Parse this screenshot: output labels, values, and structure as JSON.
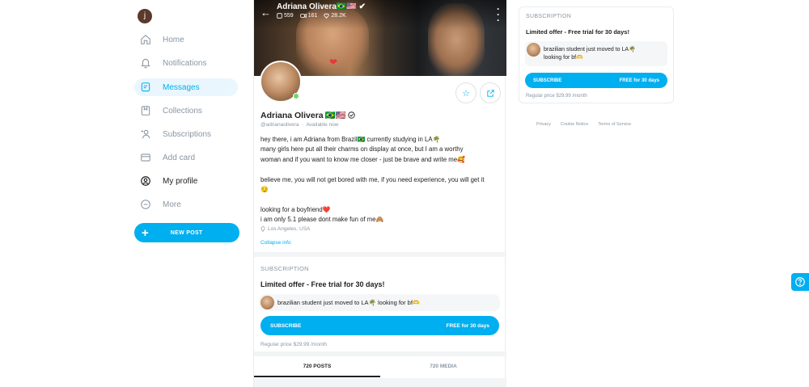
{
  "sidebar": {
    "avatar_letter": "j",
    "items": [
      {
        "label": "Home",
        "icon": "home-icon",
        "state": "normal"
      },
      {
        "label": "Notifications",
        "icon": "bell-icon",
        "state": "normal"
      },
      {
        "label": "Messages",
        "icon": "message-icon",
        "state": "active"
      },
      {
        "label": "Collections",
        "icon": "bookmark-icon",
        "state": "normal"
      },
      {
        "label": "Subscriptions",
        "icon": "subscriptions-icon",
        "state": "normal"
      },
      {
        "label": "Add card",
        "icon": "card-icon",
        "state": "normal"
      },
      {
        "label": "My profile",
        "icon": "profile-icon",
        "state": "strong"
      },
      {
        "label": "More",
        "icon": "more-icon",
        "state": "normal"
      }
    ],
    "new_post_label": "NEW POST"
  },
  "profile": {
    "cover_name": "Adriana Olivera",
    "flags": "🇧🇷🇺🇸",
    "stats": {
      "photos": "559",
      "videos": "161",
      "likes": "28.2K"
    },
    "name": "Adriana Olivera",
    "handle": "@adrianaolivera",
    "status": "Available now",
    "bio_lines": [
      "hey there, i am Adriana from Brazil🇧🇷 currently studying in LA🌴",
      "many girls here put all their charms on display at once, but I am a worthy",
      "woman and if you want to know me closer - just be brave and write me🥰",
      "",
      "believe me, you will not get bored with me, if you need experience, you will get it",
      "😏",
      "",
      "looking for a boyfriend❤️",
      "i am only 5.1 please dont make fun of me🙈"
    ],
    "location": "Los Angeles, USA",
    "collapse_label": "Collapse info"
  },
  "subscription": {
    "heading": "SUBSCRIPTION",
    "offer": "Limited offer - Free trial for 30 days!",
    "message": "brazilian student just moved to LA🌴 looking for bf🫶",
    "button_left": "SUBSCRIBE",
    "button_right": "FREE for 30 days",
    "regular_price": "Regular price $29.99 /month"
  },
  "right_panel": {
    "heading": "SUBSCRIPTION",
    "offer": "Limited offer - Free trial for 30 days!",
    "message_line1": "brazilian student just moved to LA🌴",
    "message_line2": "looking for bf🫶",
    "button_left": "SUBSCRIBE",
    "button_right": "FREE for 30 days",
    "regular_price": "Regular price $29.99 /month"
  },
  "tabs": [
    {
      "label": "720 POSTS",
      "active": true
    },
    {
      "label": "720 MEDIA",
      "active": false
    }
  ],
  "footer_links": [
    "Privacy",
    "Cookie Notice",
    "Terms of Service"
  ],
  "colors": {
    "accent": "#00aff0",
    "muted": "#8a96a3",
    "text": "#222222",
    "online": "#6cd96c"
  }
}
